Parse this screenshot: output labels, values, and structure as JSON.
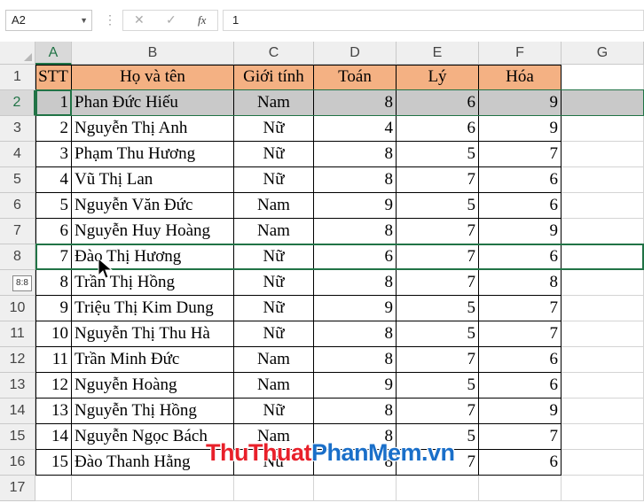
{
  "formula_bar": {
    "name_box": "A2",
    "cancel_icon": "✕",
    "enter_icon": "✓",
    "fx_label": "fx",
    "value": "1"
  },
  "columns": [
    "A",
    "B",
    "C",
    "D",
    "E",
    "F",
    "G"
  ],
  "rows": [
    "1",
    "2",
    "3",
    "4",
    "5",
    "6",
    "7",
    "8",
    "",
    "10",
    "11",
    "12",
    "13",
    "14",
    "15",
    "16",
    "17"
  ],
  "header": [
    "STT",
    "Họ và tên",
    "Giới tính",
    "Toán",
    "Lý",
    "Hóa"
  ],
  "records": [
    [
      "1",
      "Phan Đức Hiếu",
      "Nam",
      "8",
      "6",
      "9"
    ],
    [
      "2",
      "Nguyễn Thị Anh",
      "Nữ",
      "4",
      "6",
      "9"
    ],
    [
      "3",
      "Phạm Thu Hương",
      "Nữ",
      "8",
      "5",
      "7"
    ],
    [
      "4",
      "Vũ Thị Lan",
      "Nữ",
      "8",
      "7",
      "6"
    ],
    [
      "5",
      "Nguyễn Văn Đức",
      "Nam",
      "9",
      "5",
      "6"
    ],
    [
      "6",
      "Nguyễn Huy Hoàng",
      "Nam",
      "8",
      "7",
      "9"
    ],
    [
      "7",
      "Đào Thị Hương",
      "Nữ",
      "6",
      "7",
      "6"
    ],
    [
      "8",
      "Trần Thị Hồng",
      "Nữ",
      "8",
      "7",
      "8"
    ],
    [
      "9",
      "Triệu Thị Kim Dung",
      "Nữ",
      "9",
      "5",
      "7"
    ],
    [
      "10",
      "Nguyễn Thị Thu Hà",
      "Nữ",
      "8",
      "5",
      "7"
    ],
    [
      "11",
      "Trần Minh Đức",
      "Nam",
      "8",
      "7",
      "6"
    ],
    [
      "12",
      "Nguyễn Hoàng",
      "Nam",
      "9",
      "5",
      "6"
    ],
    [
      "13",
      "Nguyễn Thị Hồng",
      "Nữ",
      "8",
      "7",
      "9"
    ],
    [
      "14",
      "Nguyễn Ngọc Bách",
      "Nam",
      "8",
      "5",
      "7"
    ],
    [
      "15",
      "Đào Thanh Hằng",
      "Nữ",
      "8",
      "7",
      "6"
    ]
  ],
  "drag_tooltip": "8:8",
  "watermark": {
    "part1": "ThuThuat",
    "part2": "PhanMem",
    "part3": ".vn"
  },
  "colors": {
    "header_fill": "#f4b183",
    "selected_row_fill": "#c9c9c9",
    "accent_green": "#217346",
    "watermark_red": "#e8202a",
    "watermark_blue": "#1a6fc9"
  }
}
